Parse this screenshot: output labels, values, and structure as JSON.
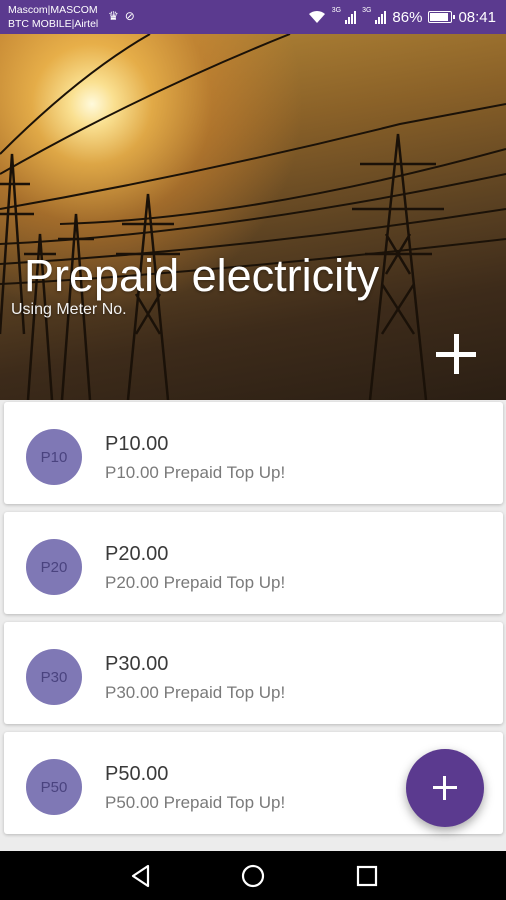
{
  "status_bar": {
    "carrier_line1": "Mascom|MASCOM",
    "carrier_line2": "BTC MOBILE|Airtel",
    "network1": "3G",
    "network2": "3G",
    "battery": "86%",
    "time": "08:41",
    "icons": [
      "crown-icon",
      "sync-icon",
      "wifi-icon",
      "signal-icon",
      "signal-icon",
      "battery-icon"
    ]
  },
  "header": {
    "title": "Prepaid electricity",
    "subtitle": "Using Meter No.",
    "add_icon": "plus-icon"
  },
  "items": [
    {
      "avatar": "P10",
      "title": "P10.00",
      "subtitle": "P10.00 Prepaid Top Up!"
    },
    {
      "avatar": "P20",
      "title": "P20.00",
      "subtitle": "P20.00 Prepaid Top Up!"
    },
    {
      "avatar": "P30",
      "title": "P30.00",
      "subtitle": "P30.00 Prepaid Top Up!"
    },
    {
      "avatar": "P50",
      "title": "P50.00",
      "subtitle": "P50.00 Prepaid Top Up!"
    }
  ],
  "fab": {
    "icon": "plus-icon"
  },
  "nav": {
    "icons": [
      "back-icon",
      "home-icon",
      "recents-icon"
    ]
  },
  "colors": {
    "primary": "#5b3a8f",
    "avatar": "#7f78b5",
    "avatar_text": "#4a437f"
  }
}
